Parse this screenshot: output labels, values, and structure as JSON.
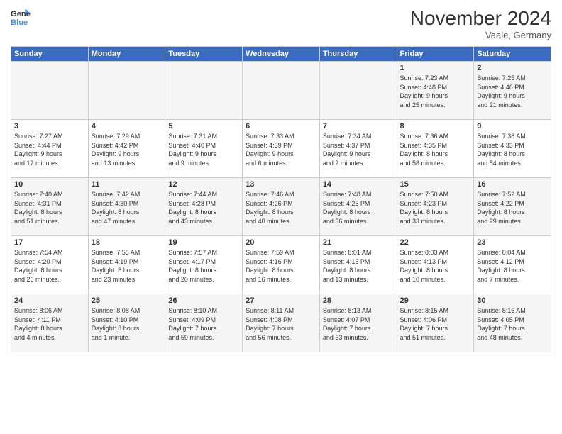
{
  "logo": {
    "line1": "General",
    "line2": "Blue"
  },
  "title": "November 2024",
  "location": "Vaale, Germany",
  "headers": [
    "Sunday",
    "Monday",
    "Tuesday",
    "Wednesday",
    "Thursday",
    "Friday",
    "Saturday"
  ],
  "weeks": [
    [
      {
        "day": "",
        "info": ""
      },
      {
        "day": "",
        "info": ""
      },
      {
        "day": "",
        "info": ""
      },
      {
        "day": "",
        "info": ""
      },
      {
        "day": "",
        "info": ""
      },
      {
        "day": "1",
        "info": "Sunrise: 7:23 AM\nSunset: 4:48 PM\nDaylight: 9 hours\nand 25 minutes."
      },
      {
        "day": "2",
        "info": "Sunrise: 7:25 AM\nSunset: 4:46 PM\nDaylight: 9 hours\nand 21 minutes."
      }
    ],
    [
      {
        "day": "3",
        "info": "Sunrise: 7:27 AM\nSunset: 4:44 PM\nDaylight: 9 hours\nand 17 minutes."
      },
      {
        "day": "4",
        "info": "Sunrise: 7:29 AM\nSunset: 4:42 PM\nDaylight: 9 hours\nand 13 minutes."
      },
      {
        "day": "5",
        "info": "Sunrise: 7:31 AM\nSunset: 4:40 PM\nDaylight: 9 hours\nand 9 minutes."
      },
      {
        "day": "6",
        "info": "Sunrise: 7:33 AM\nSunset: 4:39 PM\nDaylight: 9 hours\nand 6 minutes."
      },
      {
        "day": "7",
        "info": "Sunrise: 7:34 AM\nSunset: 4:37 PM\nDaylight: 9 hours\nand 2 minutes."
      },
      {
        "day": "8",
        "info": "Sunrise: 7:36 AM\nSunset: 4:35 PM\nDaylight: 8 hours\nand 58 minutes."
      },
      {
        "day": "9",
        "info": "Sunrise: 7:38 AM\nSunset: 4:33 PM\nDaylight: 8 hours\nand 54 minutes."
      }
    ],
    [
      {
        "day": "10",
        "info": "Sunrise: 7:40 AM\nSunset: 4:31 PM\nDaylight: 8 hours\nand 51 minutes."
      },
      {
        "day": "11",
        "info": "Sunrise: 7:42 AM\nSunset: 4:30 PM\nDaylight: 8 hours\nand 47 minutes."
      },
      {
        "day": "12",
        "info": "Sunrise: 7:44 AM\nSunset: 4:28 PM\nDaylight: 8 hours\nand 43 minutes."
      },
      {
        "day": "13",
        "info": "Sunrise: 7:46 AM\nSunset: 4:26 PM\nDaylight: 8 hours\nand 40 minutes."
      },
      {
        "day": "14",
        "info": "Sunrise: 7:48 AM\nSunset: 4:25 PM\nDaylight: 8 hours\nand 36 minutes."
      },
      {
        "day": "15",
        "info": "Sunrise: 7:50 AM\nSunset: 4:23 PM\nDaylight: 8 hours\nand 33 minutes."
      },
      {
        "day": "16",
        "info": "Sunrise: 7:52 AM\nSunset: 4:22 PM\nDaylight: 8 hours\nand 29 minutes."
      }
    ],
    [
      {
        "day": "17",
        "info": "Sunrise: 7:54 AM\nSunset: 4:20 PM\nDaylight: 8 hours\nand 26 minutes."
      },
      {
        "day": "18",
        "info": "Sunrise: 7:55 AM\nSunset: 4:19 PM\nDaylight: 8 hours\nand 23 minutes."
      },
      {
        "day": "19",
        "info": "Sunrise: 7:57 AM\nSunset: 4:17 PM\nDaylight: 8 hours\nand 20 minutes."
      },
      {
        "day": "20",
        "info": "Sunrise: 7:59 AM\nSunset: 4:16 PM\nDaylight: 8 hours\nand 16 minutes."
      },
      {
        "day": "21",
        "info": "Sunrise: 8:01 AM\nSunset: 4:15 PM\nDaylight: 8 hours\nand 13 minutes."
      },
      {
        "day": "22",
        "info": "Sunrise: 8:03 AM\nSunset: 4:13 PM\nDaylight: 8 hours\nand 10 minutes."
      },
      {
        "day": "23",
        "info": "Sunrise: 8:04 AM\nSunset: 4:12 PM\nDaylight: 8 hours\nand 7 minutes."
      }
    ],
    [
      {
        "day": "24",
        "info": "Sunrise: 8:06 AM\nSunset: 4:11 PM\nDaylight: 8 hours\nand 4 minutes."
      },
      {
        "day": "25",
        "info": "Sunrise: 8:08 AM\nSunset: 4:10 PM\nDaylight: 8 hours\nand 1 minute."
      },
      {
        "day": "26",
        "info": "Sunrise: 8:10 AM\nSunset: 4:09 PM\nDaylight: 7 hours\nand 59 minutes."
      },
      {
        "day": "27",
        "info": "Sunrise: 8:11 AM\nSunset: 4:08 PM\nDaylight: 7 hours\nand 56 minutes."
      },
      {
        "day": "28",
        "info": "Sunrise: 8:13 AM\nSunset: 4:07 PM\nDaylight: 7 hours\nand 53 minutes."
      },
      {
        "day": "29",
        "info": "Sunrise: 8:15 AM\nSunset: 4:06 PM\nDaylight: 7 hours\nand 51 minutes."
      },
      {
        "day": "30",
        "info": "Sunrise: 8:16 AM\nSunset: 4:05 PM\nDaylight: 7 hours\nand 48 minutes."
      }
    ]
  ]
}
